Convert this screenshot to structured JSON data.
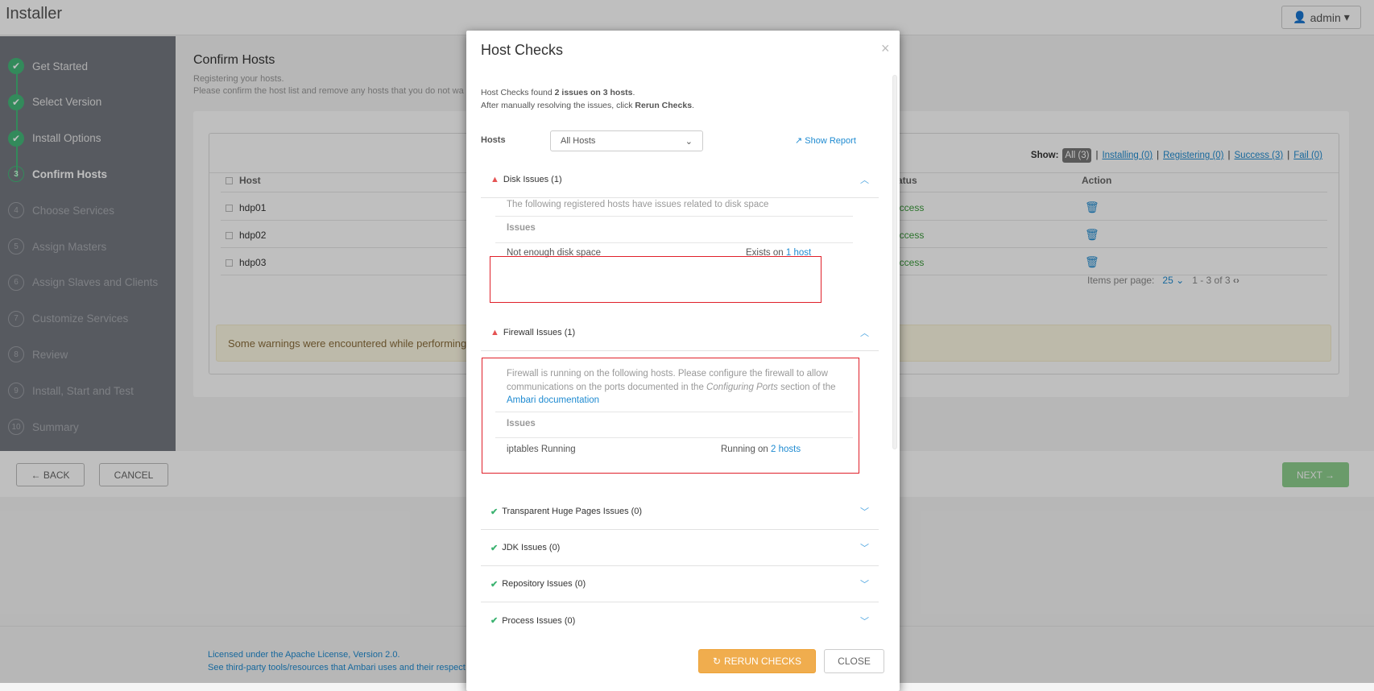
{
  "header": {
    "title": "Installer",
    "user": "admin"
  },
  "sidebar": {
    "steps": [
      {
        "num": "1",
        "label": "Get Started",
        "state": "done"
      },
      {
        "num": "2",
        "label": "Select Version",
        "state": "done"
      },
      {
        "num": "3",
        "label": "Install Options",
        "state": "done"
      },
      {
        "num": "3",
        "label": "Confirm Hosts",
        "state": "current"
      },
      {
        "num": "4",
        "label": "Choose Services",
        "state": "todo"
      },
      {
        "num": "5",
        "label": "Assign Masters",
        "state": "todo"
      },
      {
        "num": "6",
        "label": "Assign Slaves and Clients",
        "state": "todo"
      },
      {
        "num": "7",
        "label": "Customize Services",
        "state": "todo"
      },
      {
        "num": "8",
        "label": "Review",
        "state": "todo"
      },
      {
        "num": "9",
        "label": "Install, Start and Test",
        "state": "todo"
      },
      {
        "num": "10",
        "label": "Summary",
        "state": "todo"
      }
    ]
  },
  "main": {
    "title": "Confirm Hosts",
    "subtitle1": "Registering your hosts.",
    "subtitle2": "Please confirm the host list and remove any hosts that you do not wa",
    "show_label": "Show:",
    "filters": [
      "All (3)",
      "Installing (0)",
      "Registering (0)",
      "Success (3)",
      "Fail (0)"
    ],
    "columns": {
      "host": "Host",
      "status": "tatus",
      "action": "Action"
    },
    "rows": [
      {
        "host": "hdp01",
        "status": "uccess"
      },
      {
        "host": "hdp02",
        "status": "uccess"
      },
      {
        "host": "hdp03",
        "status": "uccess"
      }
    ],
    "pagination": {
      "label": "Items per page:",
      "per_page": "25",
      "range": "1 - 3 of 3"
    },
    "warning": "Some warnings were encountered while performing c"
  },
  "footer": {
    "back": "← BACK",
    "cancel": "CANCEL",
    "next": "NEXT →",
    "license": "Licensed under the Apache License, Version 2.0.",
    "thirdparty": "See third-party tools/resources that Ambari uses and their respect"
  },
  "modal": {
    "title": "Host Checks",
    "close": "×",
    "summary_pre": "Host Checks found ",
    "summary_bold": "2 issues on 3 hosts",
    "summary_post": ".",
    "after_pre": "After manually resolving the issues, click ",
    "after_bold": "Rerun Checks",
    "after_post": ".",
    "hosts_label": "Hosts",
    "hosts_value": "All Hosts",
    "show_report": "Show Report",
    "disk": {
      "title": "Disk Issues (1)",
      "text": "The following registered hosts have issues related to disk space",
      "issues_label": "Issues",
      "issue": "Not enough disk space",
      "where": "Exists on ",
      "link": "1 host"
    },
    "firewall": {
      "title": "Firewall Issues (1)",
      "text1": "Firewall is running on the following hosts. Please configure the firewall to allow communications on the ports documented in the ",
      "text_em": "Configuring Ports",
      "text2": " section of the ",
      "link_doc": "Ambari documentation",
      "issues_label": "Issues",
      "issue": "iptables Running",
      "where": "Running on ",
      "link": "2 hosts"
    },
    "ok_sections": [
      "Transparent Huge Pages Issues (0)",
      "JDK Issues (0)",
      "Repository Issues (0)",
      "Process Issues (0)"
    ],
    "rerun": "RERUN CHECKS",
    "close_btn": "CLOSE"
  },
  "colors": {
    "accent": "#1f8bd1",
    "success": "#45b87a",
    "warning": "#f0ad4e",
    "error": "#e55353",
    "highlight": "#e0202a"
  }
}
